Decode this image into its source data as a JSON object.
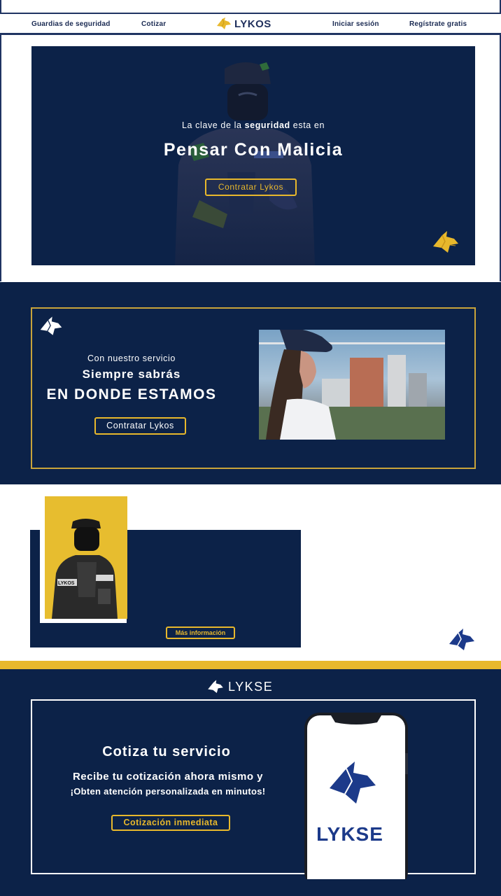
{
  "nav": {
    "link_guards": "Guardias de seguridad",
    "link_quote": "Cotizar",
    "brand": "LYKOS",
    "link_login": "Iniciar sesión",
    "link_register": "Regístrate gratis"
  },
  "hero": {
    "kicker_before": "La clave de la ",
    "kicker_bold": "seguridad",
    "kicker_after": " esta en",
    "headline": "Pensar Con Malicia",
    "cta": "Contratar Lykos",
    "badge_text": "LYKOS"
  },
  "service": {
    "line1": "Con nuestro servicio",
    "line2": "Siempre sabrás",
    "line3": "EN DONDE ESTAMOS",
    "cta": "Contratar Lykos"
  },
  "info": {
    "cta": "Más información",
    "vest_text": "LYKOS"
  },
  "lykse": {
    "brand": "LYKSE",
    "title": "Cotiza tu servicio",
    "sub1": "Recibe tu cotización ahora mismo y",
    "sub2": "¡Obten atención personalizada en minutos!",
    "cta": "Cotización inmediata",
    "phone_word": "LYKSE"
  },
  "colors": {
    "navy": "#0c2248",
    "gold": "#e8b82c",
    "white": "#ffffff"
  }
}
